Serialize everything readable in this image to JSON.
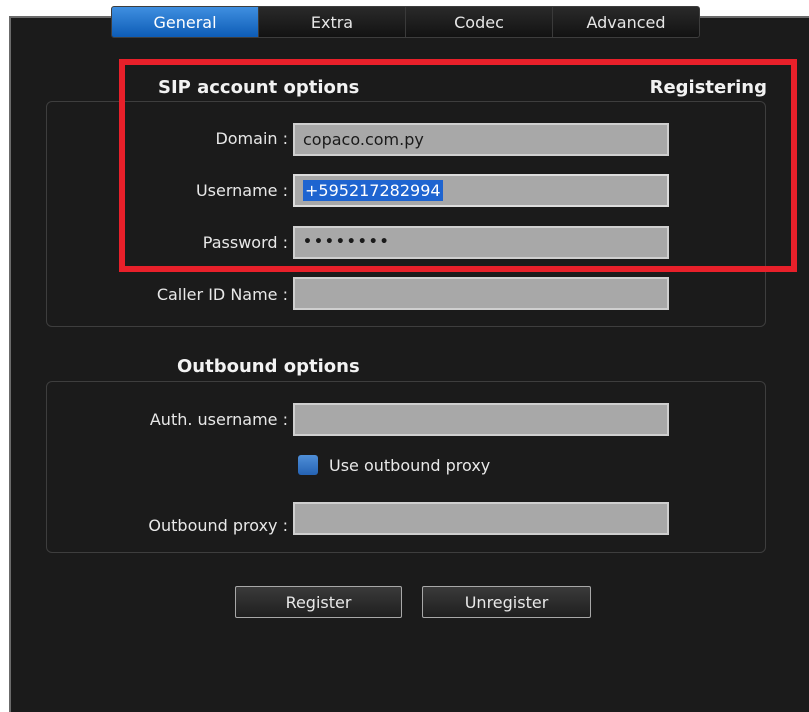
{
  "tabs": [
    "General",
    "Extra",
    "Codec",
    "Advanced"
  ],
  "sip": {
    "heading": "SIP account options",
    "status": "Registering",
    "domain_label": "Domain :",
    "domain_value": "copaco.com.py",
    "username_label": "Username :",
    "username_value": "+595217282994",
    "password_label": "Password :",
    "password_value": "••••••••",
    "callerid_label": "Caller ID Name :",
    "callerid_value": ""
  },
  "outbound": {
    "heading": "Outbound options",
    "auth_label": "Auth. username :",
    "auth_value": "",
    "proxy_checkbox_label": "Use outbound proxy",
    "proxy_checked": true,
    "proxy_label": "Outbound proxy :",
    "proxy_value": ""
  },
  "buttons": {
    "register": "Register",
    "unregister": "Unregister"
  },
  "colors": {
    "accent": "#1e64d0",
    "highlight_box": "#e8202a",
    "background": "#1b1b1b"
  }
}
